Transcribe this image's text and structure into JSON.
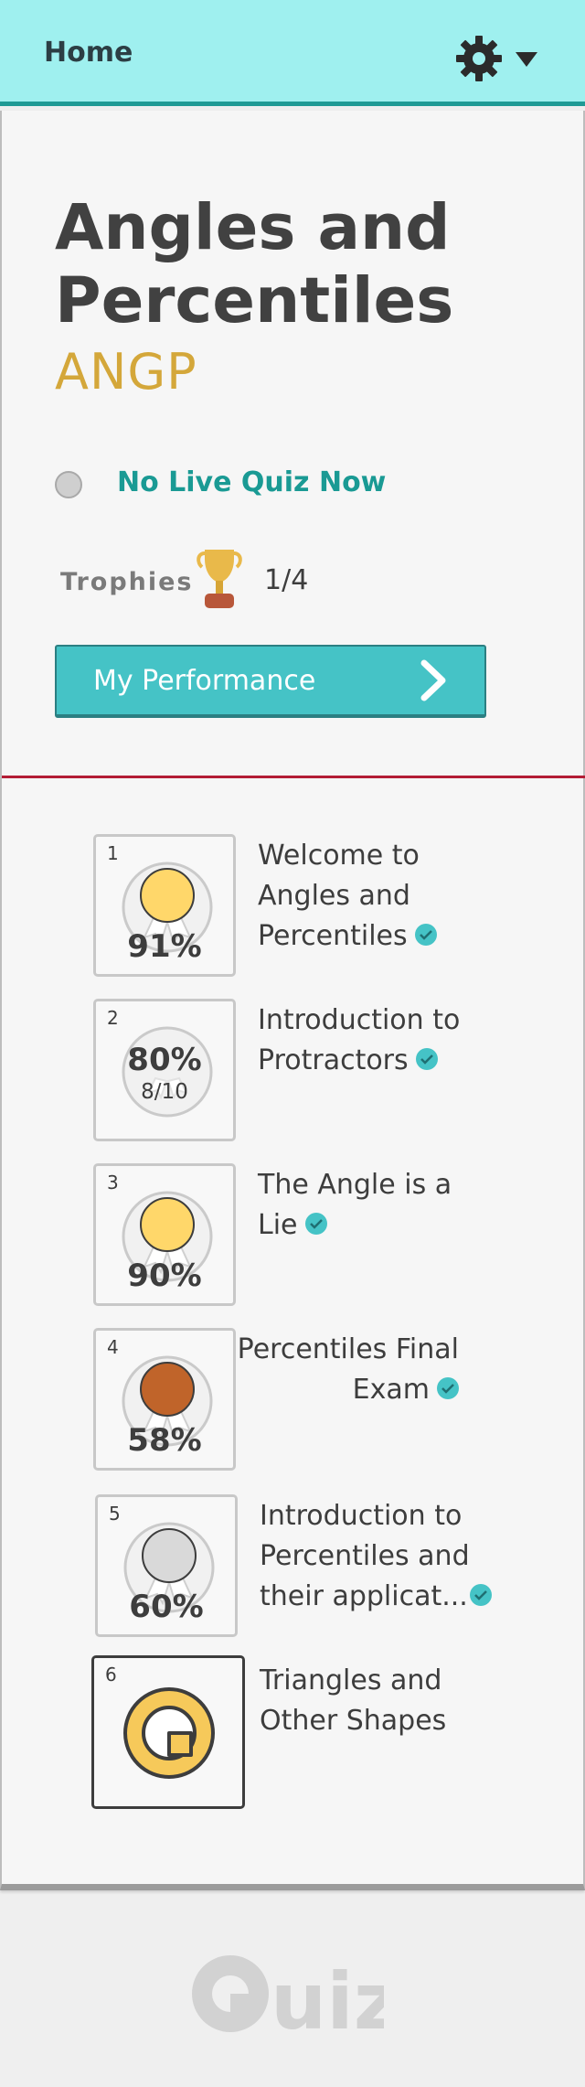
{
  "header": {
    "home_label": "Home"
  },
  "course": {
    "title": "Angles and Percentiles",
    "code": "ANGP",
    "live_status": "No Live Quiz Now",
    "trophies_label": "Trophies",
    "trophies_count": "1/4",
    "performance_button": "My Performance"
  },
  "lessons": [
    {
      "number": "1",
      "score": "91%",
      "title_lines": [
        "Welcome to",
        "Angles and",
        "Percentiles"
      ],
      "medal": "gold",
      "completed": true
    },
    {
      "number": "2",
      "score": "80%",
      "detail": "8/10",
      "title_lines": [
        "Introduction to",
        "Protractors"
      ],
      "medal": "none",
      "completed": true
    },
    {
      "number": "3",
      "score": "90%",
      "title_lines": [
        "The Angle is a",
        "Lie"
      ],
      "medal": "gold",
      "completed": true
    },
    {
      "number": "4",
      "score": "58%",
      "title_lines": [
        "Percentiles Final",
        "Exam"
      ],
      "medal": "bronze",
      "completed": true
    },
    {
      "number": "5",
      "score": "60%",
      "title_lines": [
        "Introduction to",
        "Percentiles and",
        "their applicat..."
      ],
      "medal": "silver",
      "completed": true
    },
    {
      "number": "6",
      "score": "",
      "title_lines": [
        "Triangles and",
        "Other Shapes"
      ],
      "medal": "quiz-token",
      "completed": false
    }
  ],
  "footer": {
    "logo_text": "Quiz"
  },
  "colors": {
    "header_bg": "#9ff0ef",
    "accent_teal": "#45c3c6",
    "code_gold": "#d4a73a",
    "divider_red": "#b31d35",
    "gold_medal": "#ffd76a",
    "bronze_medal": "#c0642a",
    "silver_medal": "#d9d9d9"
  },
  "icons": {
    "settings": "gear-icon",
    "dropdown": "caret-down-icon",
    "trophy": "trophy-icon",
    "next": "chevron-right-icon",
    "completed": "check-circle-icon"
  }
}
